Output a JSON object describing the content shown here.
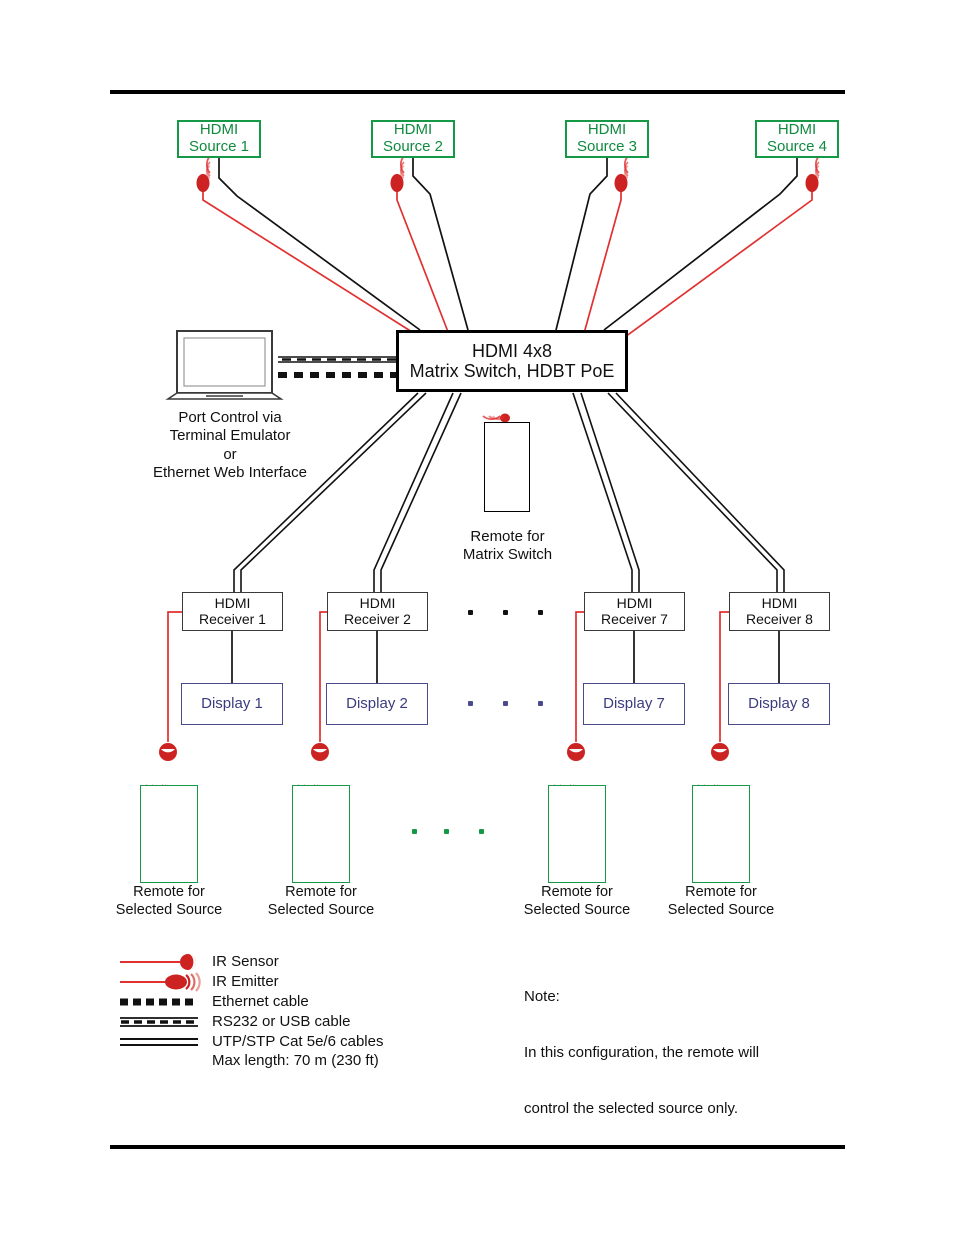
{
  "diagram": {
    "title": "HDMI 4x8 Matrix Switch HDBT PoE connection diagram",
    "colors": {
      "source_green": "#0f8a3f",
      "display_blue": "#3b3b80",
      "ir_red": "#e03030",
      "black": "#111111"
    },
    "sources": [
      {
        "line1": "HDMI",
        "line2": "Source 1"
      },
      {
        "line1": "HDMI",
        "line2": "Source 2"
      },
      {
        "line1": "HDMI",
        "line2": "Source 3"
      },
      {
        "line1": "HDMI",
        "line2": "Source 4"
      }
    ],
    "switch": {
      "line1": "HDMI 4x8",
      "line2": "Matrix Switch, HDBT PoE"
    },
    "control_pc": {
      "caption_line1": "Port Control via",
      "caption_line2": "Terminal Emulator",
      "caption_line3": "or",
      "caption_line4": "Ethernet Web Interface"
    },
    "matrix_remote": {
      "caption_line1": "Remote for",
      "caption_line2": "Matrix Switch"
    },
    "receivers": [
      {
        "line1": "HDMI",
        "line2": "Receiver 1"
      },
      {
        "line1": "HDMI",
        "line2": "Receiver 2"
      },
      {
        "line1": "HDMI",
        "line2": "Receiver 7"
      },
      {
        "line1": "HDMI",
        "line2": "Receiver 8"
      }
    ],
    "displays": [
      {
        "label": "Display 1"
      },
      {
        "label": "Display 2"
      },
      {
        "label": "Display 7"
      },
      {
        "label": "Display 8"
      }
    ],
    "source_remotes": [
      {
        "caption_line1": "Remote for",
        "caption_line2": "Selected Source"
      },
      {
        "caption_line1": "Remote for",
        "caption_line2": "Selected Source"
      },
      {
        "caption_line1": "Remote for",
        "caption_line2": "Selected Source"
      },
      {
        "caption_line1": "Remote for",
        "caption_line2": "Selected Source"
      }
    ],
    "ellipsis": {
      "glyph": "•",
      "repeat": 3
    },
    "legend": [
      {
        "symbol": "ir-sensor-symbol",
        "label": "IR Sensor"
      },
      {
        "symbol": "ir-emitter-symbol",
        "label": "IR Emitter"
      },
      {
        "symbol": "ethernet-cable-symbol",
        "label": "Ethernet cable"
      },
      {
        "symbol": "rs232-usb-cable-symbol",
        "label": "RS232 or USB cable"
      },
      {
        "symbol": "utp-stp-cable-symbol",
        "label": "UTP/STP Cat 5e/6 cables"
      }
    ],
    "legend_sub": "Max length: 70 m (230 ft)",
    "note": {
      "heading": "Note:",
      "line1": "In this configuration, the remote will",
      "line2": "control the selected source only."
    }
  }
}
